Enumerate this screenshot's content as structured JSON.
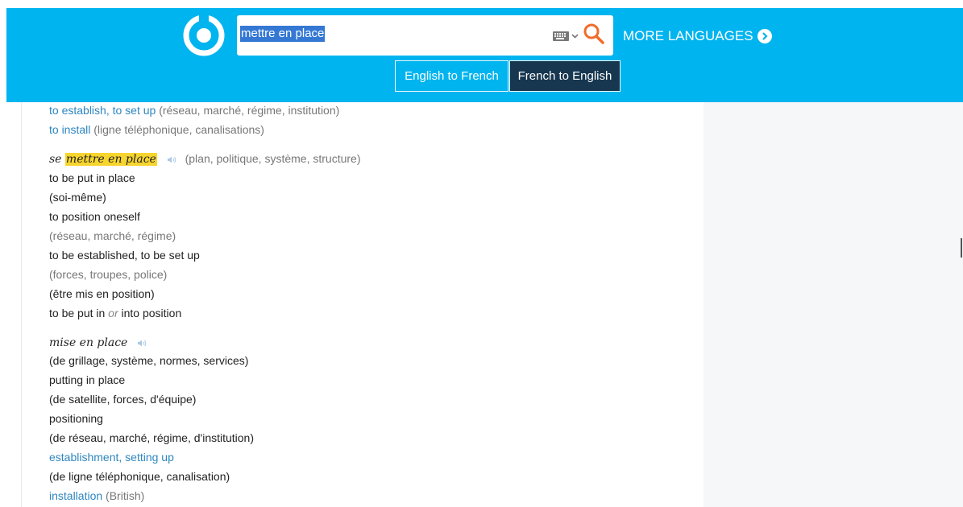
{
  "header": {
    "search": {
      "value": "mettre en place"
    },
    "more_languages": "MORE LANGUAGES",
    "tabs": [
      {
        "label": "English to French",
        "active": false
      },
      {
        "label": "French to English",
        "active": true
      }
    ],
    "icons": [
      "logo-icon",
      "keyboard-icon",
      "chevron-down-icon",
      "search-icon",
      "arrow-right-circle-icon"
    ]
  },
  "entries": {
    "top_senses": [
      {
        "translation": "to establish, to set up",
        "context": " (réseau, marché, régime, institution)"
      },
      {
        "translation": "to install",
        "context": " (ligne téléphonique, canalisations)"
      }
    ],
    "reflexive": {
      "prefix": "se ",
      "head": "mettre en place",
      "context": "(plan, politique, système, structure)",
      "lines": [
        {
          "text": "to be put in place",
          "style": "dark"
        },
        {
          "text": "(soi-même)",
          "style": "dark"
        },
        {
          "text": "to position oneself",
          "style": "dark"
        },
        {
          "text": "(réseau, marché, régime)",
          "style": "gray"
        },
        {
          "text": "to be established, to be set up",
          "style": "dark"
        },
        {
          "text": "(forces, troupes, police)",
          "style": "gray"
        },
        {
          "text": "(être mis en position)",
          "style": "dark"
        }
      ],
      "last_line": {
        "before": "to be put in ",
        "or": "or",
        "after": " into position"
      }
    },
    "noun": {
      "head": "mise en place",
      "lines": [
        {
          "text": "(de grillage, système, normes, services)",
          "style": "dark"
        },
        {
          "text": "putting in place",
          "style": "dark"
        },
        {
          "text": "(de satellite, forces, d'équipe)",
          "style": "dark"
        },
        {
          "text": "positioning",
          "style": "dark"
        },
        {
          "text": "(de réseau, marché, régime, d'institution)",
          "style": "dark"
        },
        {
          "text": "establishment, setting up",
          "style": "blue"
        },
        {
          "text": "(de ligne téléphonique, canalisation)",
          "style": "dark"
        }
      ],
      "last_line": {
        "translation": "installation",
        "note": " (British)"
      }
    }
  },
  "colors": {
    "header_bg": "#00b4ef",
    "active_tab_bg": "#17364f",
    "link": "#2e86c1",
    "highlight": "#f7d52f",
    "search_icon": "#f26b2a"
  }
}
